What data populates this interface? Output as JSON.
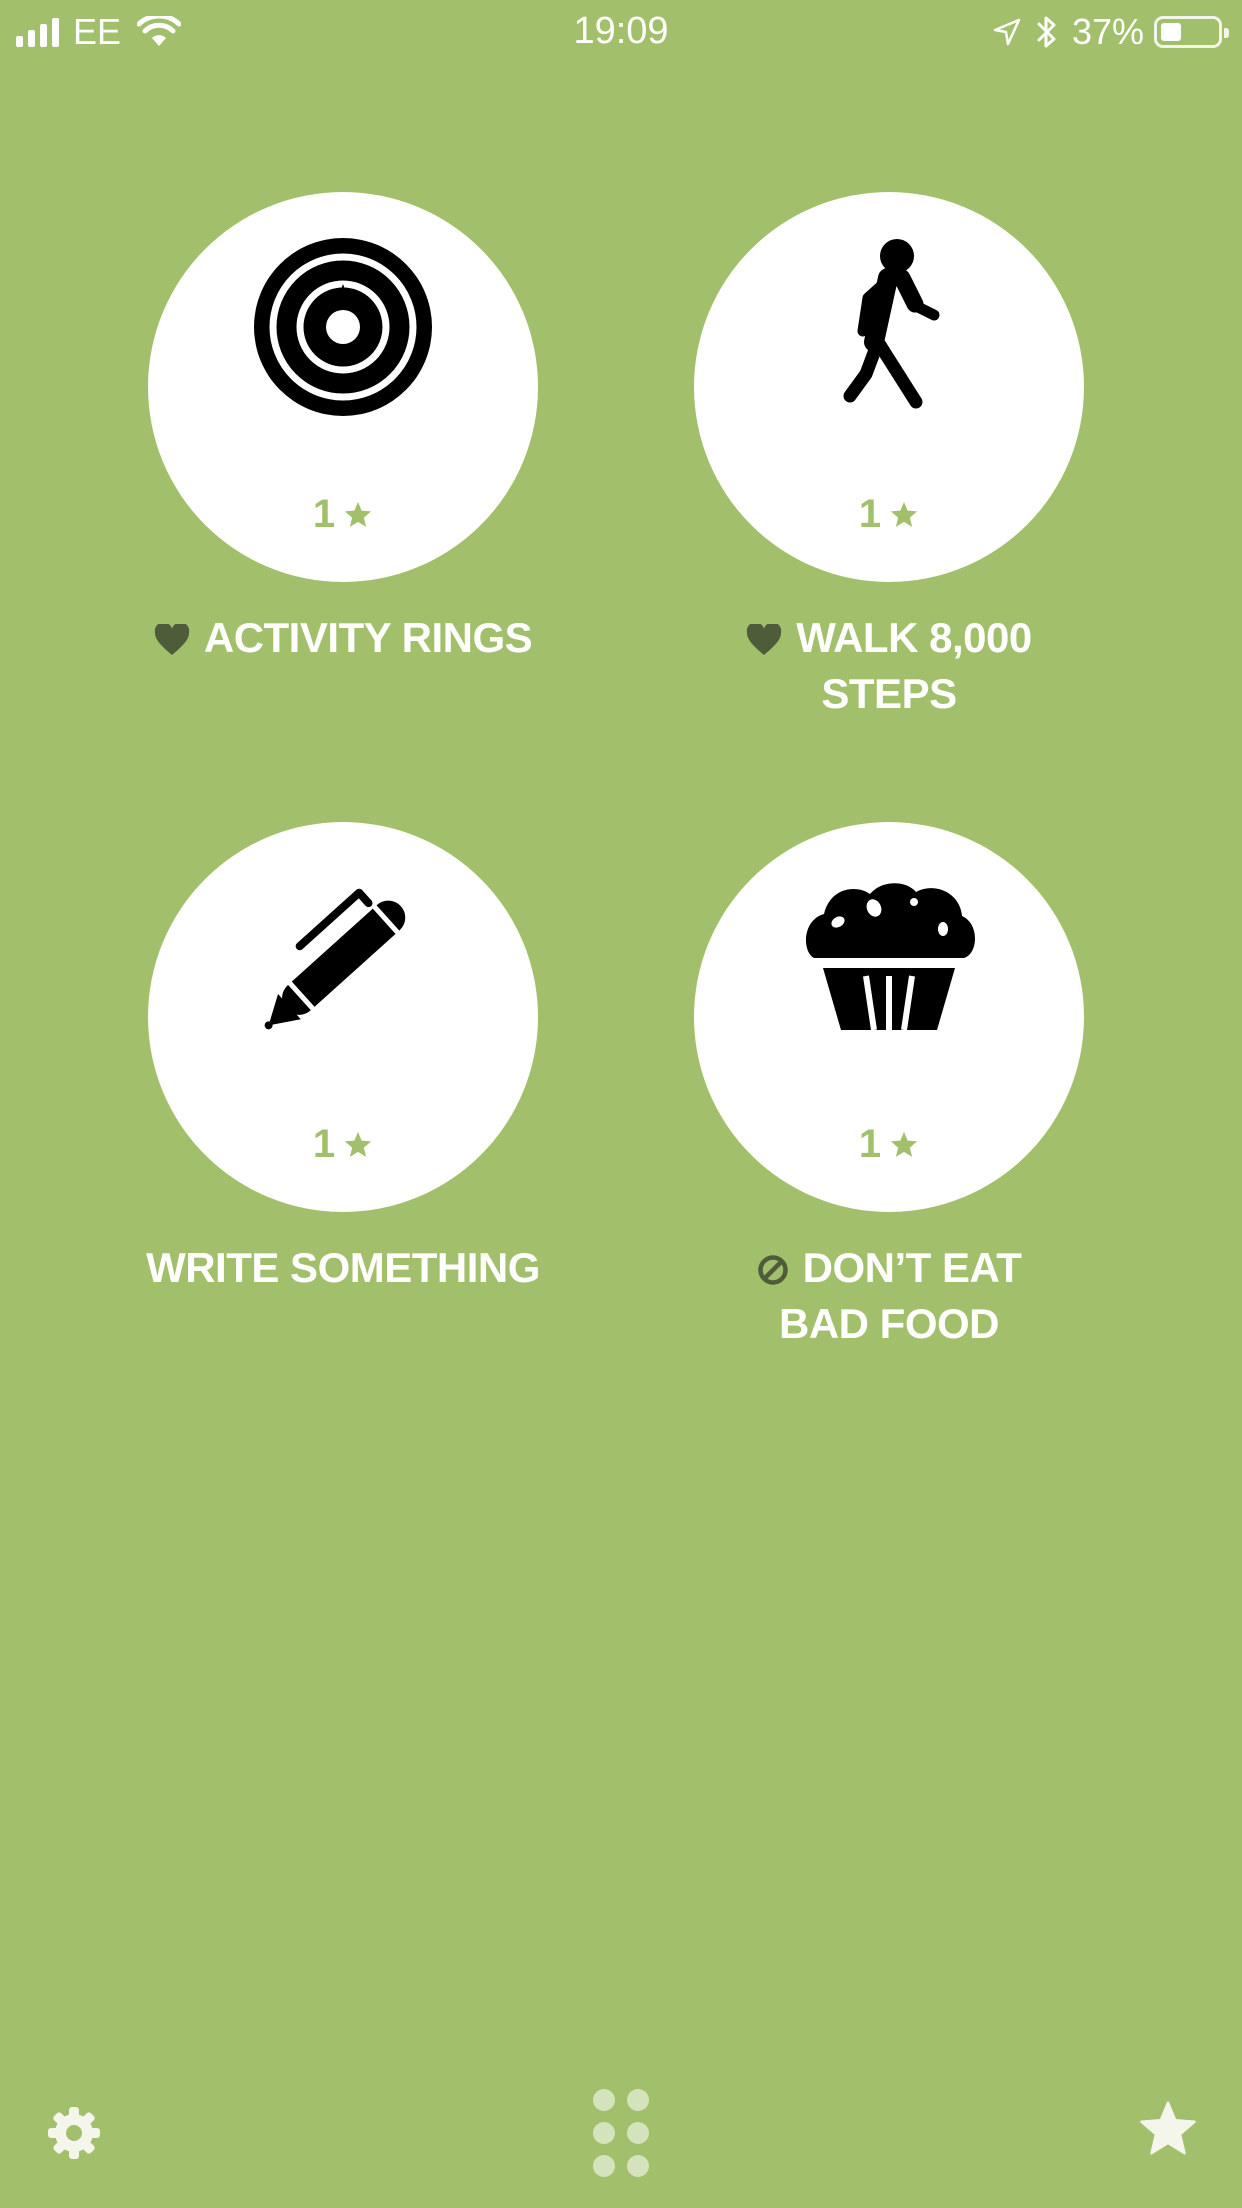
{
  "status_bar": {
    "carrier": "EE",
    "time": "19:09",
    "battery_percent": "37%",
    "battery_level": 0.37,
    "signal_bars": 4,
    "icons": [
      "signal-icon",
      "wifi-icon",
      "location-icon",
      "bluetooth-icon",
      "battery-icon"
    ]
  },
  "theme": {
    "background": "#a2bf6b",
    "circle": "#ffffff",
    "icon": "#000000",
    "accent_star": "#a2bf6b",
    "title_text": "#ffffff",
    "badge_icon": "#4e5c3a"
  },
  "habits": [
    {
      "title": "ACTIVITY RINGS",
      "stars": "1",
      "icon": "target-icon",
      "badge": "heart-icon"
    },
    {
      "title": "WALK 8,000\nSTEPS",
      "stars": "1",
      "icon": "walking-person-icon",
      "badge": "heart-icon"
    },
    {
      "title": "WRITE SOMETHING",
      "stars": "1",
      "icon": "pen-icon",
      "badge": ""
    },
    {
      "title": "DON’T EAT\nBAD FOOD",
      "stars": "1",
      "icon": "muffin-icon",
      "badge": "no-entry-icon"
    }
  ],
  "toolbar": {
    "items": [
      "settings-icon",
      "grid-icon",
      "star-icon"
    ]
  }
}
